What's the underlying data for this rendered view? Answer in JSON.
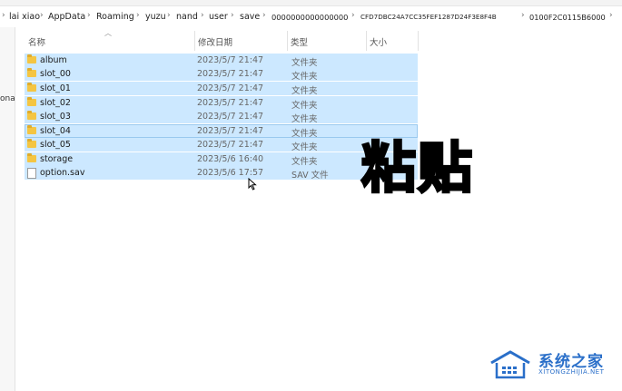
{
  "breadcrumb": {
    "items": [
      "lai xiao",
      "AppData",
      "Roaming",
      "yuzu",
      "nand",
      "user",
      "save",
      "0000000000000000",
      "CFD7DBC24A7CC35FEF1287D24F3E8F4B",
      "0100F2C0115B6000"
    ],
    "separator": "›"
  },
  "left_pane": {
    "fragment": "ona"
  },
  "columns": {
    "name": "名称",
    "date": "修改日期",
    "type": "类型",
    "size": "大小"
  },
  "files": [
    {
      "name": "album",
      "date": "2023/5/7 21:47",
      "type": "文件夹",
      "size": "",
      "icon": "folder-icon"
    },
    {
      "name": "slot_00",
      "date": "2023/5/7 21:47",
      "type": "文件夹",
      "size": "",
      "icon": "folder-icon"
    },
    {
      "name": "slot_01",
      "date": "2023/5/7 21:47",
      "type": "文件夹",
      "size": "",
      "icon": "folder-icon"
    },
    {
      "name": "slot_02",
      "date": "2023/5/7 21:47",
      "type": "文件夹",
      "size": "",
      "icon": "folder-icon"
    },
    {
      "name": "slot_03",
      "date": "2023/5/7 21:47",
      "type": "文件夹",
      "size": "",
      "icon": "folder-icon"
    },
    {
      "name": "slot_04",
      "date": "2023/5/7 21:47",
      "type": "文件夹",
      "size": "",
      "icon": "folder-icon"
    },
    {
      "name": "slot_05",
      "date": "2023/5/7 21:47",
      "type": "文件夹",
      "size": "",
      "icon": "folder-icon"
    },
    {
      "name": "storage",
      "date": "2023/5/6 16:40",
      "type": "文件夹",
      "size": "",
      "icon": "folder-icon"
    },
    {
      "name": "option.sav",
      "date": "2023/5/6 17:57",
      "type": "SAV 文件",
      "size": "",
      "icon": "file-icon"
    }
  ],
  "overlay": {
    "text": "粘贴"
  },
  "watermark": {
    "title": "系统之家",
    "subtitle": "XITONGZHIJIA.NET"
  },
  "colors": {
    "selection": "#cce8ff",
    "selection_border": "#99c9ef",
    "watermark": "#2a6fc9",
    "folder": "#f4c542"
  }
}
